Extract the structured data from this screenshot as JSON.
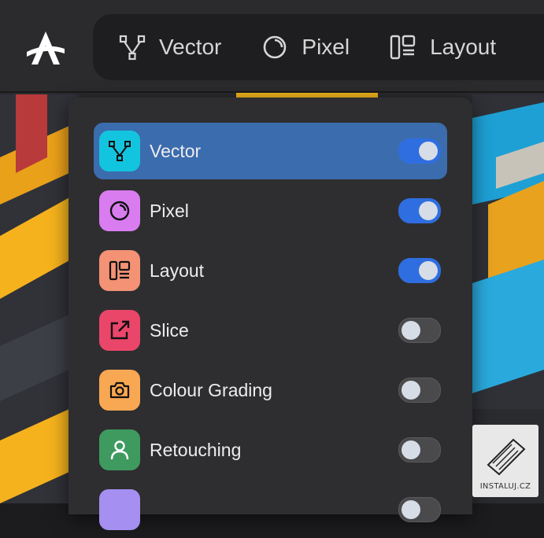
{
  "personas": [
    {
      "label": "Vector",
      "icon": "vector-nodes-icon"
    },
    {
      "label": "Pixel",
      "icon": "pixel-circle-icon"
    },
    {
      "label": "Layout",
      "icon": "layout-columns-icon"
    }
  ],
  "menu": {
    "items": [
      {
        "label": "Vector",
        "icon": "vector-nodes-icon",
        "tile_color": "#13c4df",
        "enabled": true,
        "active": true
      },
      {
        "label": "Pixel",
        "icon": "pixel-circle-icon",
        "tile_color": "#d97cf0",
        "enabled": true,
        "active": false
      },
      {
        "label": "Layout",
        "icon": "layout-columns-icon",
        "tile_color": "#f39275",
        "enabled": true,
        "active": false
      },
      {
        "label": "Slice",
        "icon": "export-arrow-icon",
        "tile_color": "#ea466a",
        "enabled": false,
        "active": false
      },
      {
        "label": "Colour Grading",
        "icon": "camera-icon",
        "tile_color": "#f8a752",
        "enabled": false,
        "active": false
      },
      {
        "label": "Retouching",
        "icon": "person-icon",
        "tile_color": "#3f9a60",
        "enabled": false,
        "active": false
      },
      {
        "label": "",
        "icon": "unknown-icon",
        "tile_color": "#a58ff0",
        "enabled": false,
        "active": false
      }
    ]
  },
  "watermark": {
    "text": "INSTALUJ.CZ"
  },
  "colors": {
    "active_row": "#3b6cae",
    "toggle_on": "#2f6ee0",
    "toggle_off": "#4a4a4c"
  }
}
